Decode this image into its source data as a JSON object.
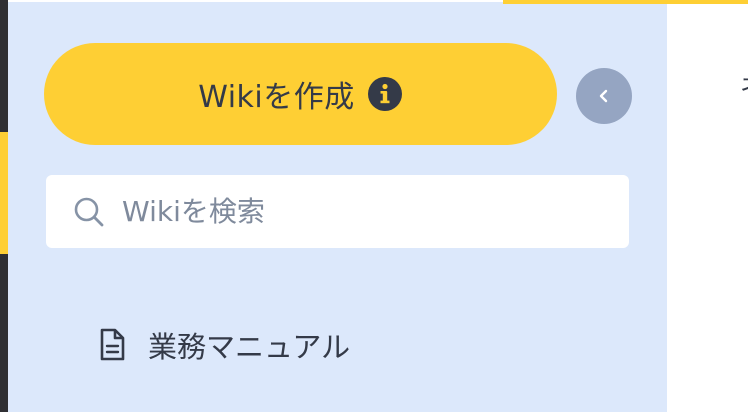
{
  "sidebar": {
    "create_button": {
      "label": "Wikiを作成",
      "icon": "info-icon"
    },
    "collapse_button": {
      "icon": "chevron-left-icon"
    },
    "search": {
      "placeholder": "Wikiを検索",
      "value": "",
      "icon": "search-icon"
    },
    "tree": {
      "items": [
        {
          "label": "業務マニュアル",
          "icon": "document-icon"
        }
      ]
    }
  },
  "main": {
    "clipped_text": "ネ"
  },
  "colors": {
    "accent": "#fecf34",
    "sidebar_bg": "#dce8fb",
    "collapse_bg": "#95a5c2",
    "text": "#343a48",
    "placeholder": "#7f8a9c",
    "app_rail": "#2f2f33"
  }
}
